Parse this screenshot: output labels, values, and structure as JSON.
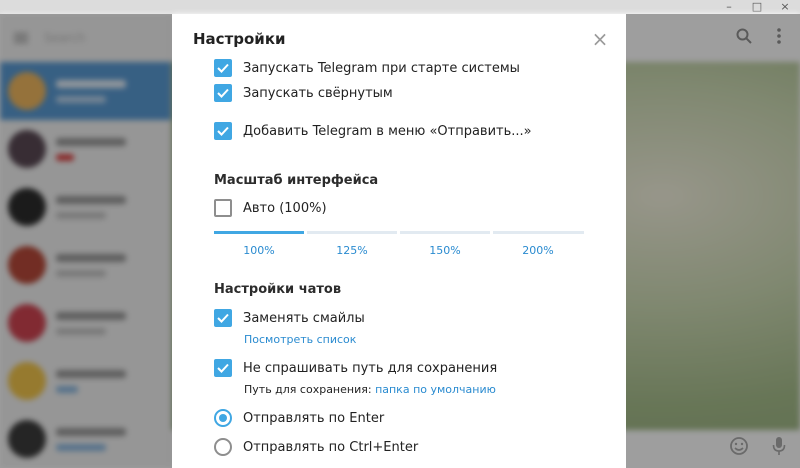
{
  "window": {
    "minimize": "–",
    "maximize": "□",
    "close": "×"
  },
  "background": {
    "search_placeholder": "Search",
    "chats_count": 7
  },
  "header_icons": {
    "search": "search-icon",
    "more": "more-vertical-icon"
  },
  "bottom_icons": {
    "emoji": "emoji-icon",
    "mic": "microphone-icon"
  },
  "dialog": {
    "title": "Настройки",
    "close": "×",
    "general": {
      "items": [
        {
          "label": "Запускать Telegram при старте системы",
          "checked": true
        },
        {
          "label": "Запускать свёрнутым",
          "checked": true
        },
        {
          "label": "Добавить Telegram в меню «Отправить...»",
          "checked": true
        }
      ]
    },
    "scale": {
      "title": "Масштаб интерфейса",
      "auto_label": "Авто (100%)",
      "auto_checked": false,
      "options": [
        "100%",
        "125%",
        "150%",
        "200%"
      ],
      "selected_index": 0
    },
    "chat_settings": {
      "title": "Настройки чатов",
      "replace_emoji": "Заменять смайлы",
      "view_list": "Посмотреть список",
      "dont_ask_path": "Не спрашивать путь для сохранения",
      "save_path_label": "Путь для сохранения:",
      "save_path_value": "папка по умолчанию",
      "send_enter": "Отправлять по Enter",
      "send_ctrl_enter": "Отправлять по Ctrl+Enter",
      "send_mode": "enter"
    }
  },
  "colors": {
    "accent": "#40a7e3",
    "link": "#2a8bd0",
    "active_chat": "#5a9bd4"
  }
}
